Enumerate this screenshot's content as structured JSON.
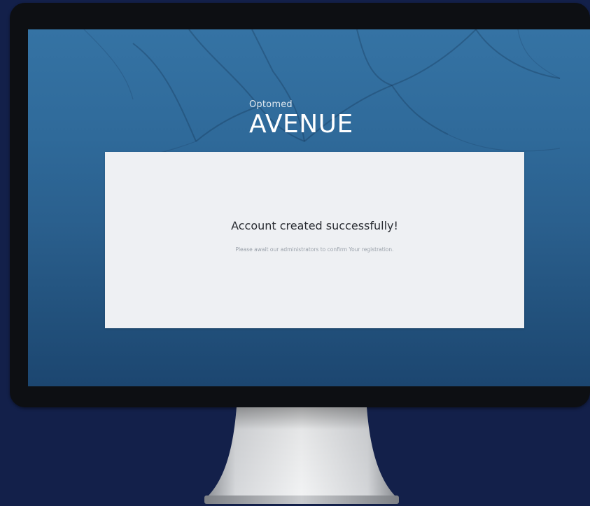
{
  "app": {
    "brand_small": "Optomed",
    "brand_large": "AVENUE"
  },
  "message": {
    "title": "Account created successfully!",
    "body": "Please await our administrators to confirm Your registration."
  },
  "colors": {
    "background": "#13204a",
    "screen_top": "#3573a4",
    "screen_bottom": "#1c4670",
    "card": "#eef0f3",
    "bezel": "#0d0f13"
  }
}
